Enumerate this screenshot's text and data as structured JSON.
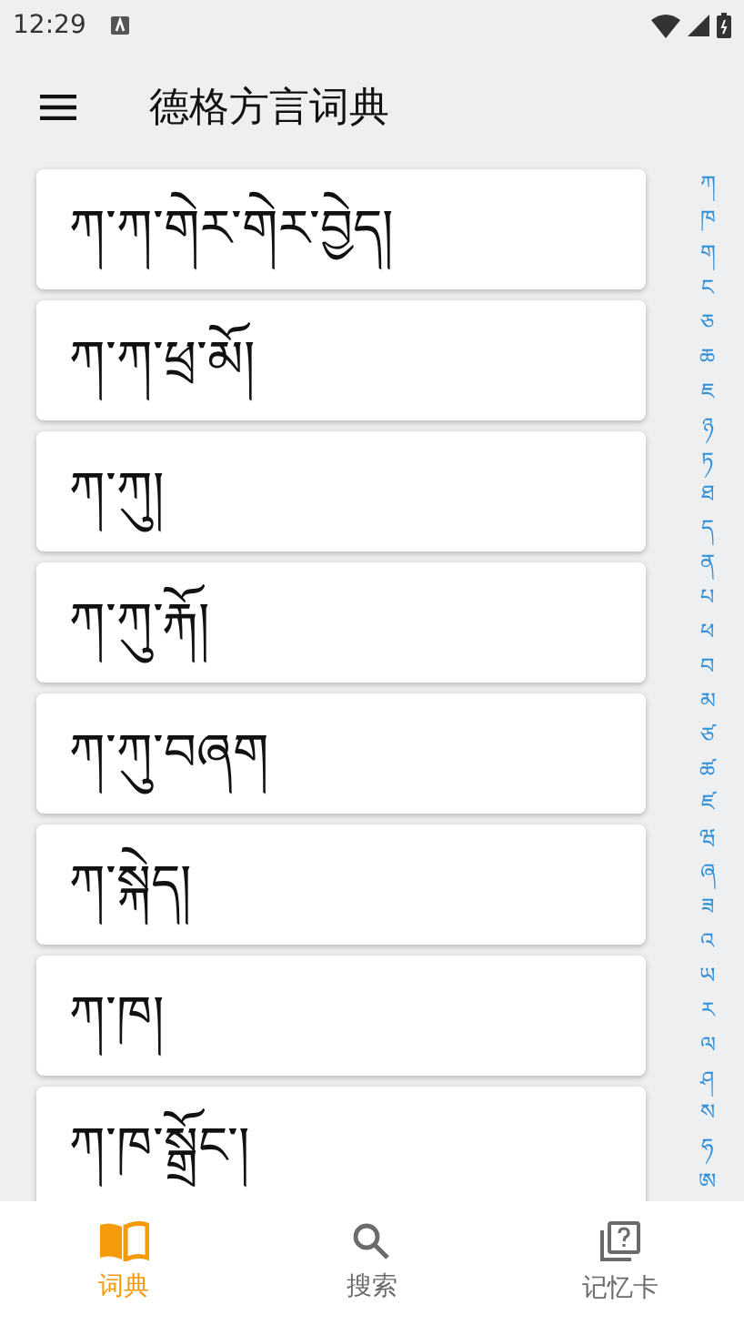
{
  "status_bar": {
    "time": "12:29"
  },
  "app_bar": {
    "title": "德格方言词典"
  },
  "entries": [
    "ཀ་ཀ་གེར་གེར་བྱེད།",
    "ཀ་ཀ་ཕྲ་མོ།",
    "ཀ་ཀུ།",
    "ཀ་ཀུ་རྐོ།",
    "ཀ་ཀུ་བཞག",
    "ཀ་སྐེད།",
    "ཀ་ཁ།",
    "ཀ་ཁ་སྒྲོང་།"
  ],
  "index": [
    "ཀ",
    "ཁ",
    "ག",
    "ང",
    "ཅ",
    "ཆ",
    "ཇ",
    "ཉ",
    "ཏ",
    "ཐ",
    "ད",
    "ན",
    "པ",
    "ཕ",
    "བ",
    "མ",
    "ཙ",
    "ཚ",
    "ཛ",
    "ཝ",
    "ཞ",
    "ཟ",
    "འ",
    "ཡ",
    "ར",
    "ལ",
    "ཤ",
    "ས",
    "ཧ",
    "ཨ"
  ],
  "bottom_nav": [
    {
      "kind": "book",
      "label": "词典",
      "selected": true
    },
    {
      "kind": "search",
      "label": "搜索",
      "selected": false
    },
    {
      "kind": "cards",
      "label": "记忆卡",
      "selected": false
    }
  ]
}
